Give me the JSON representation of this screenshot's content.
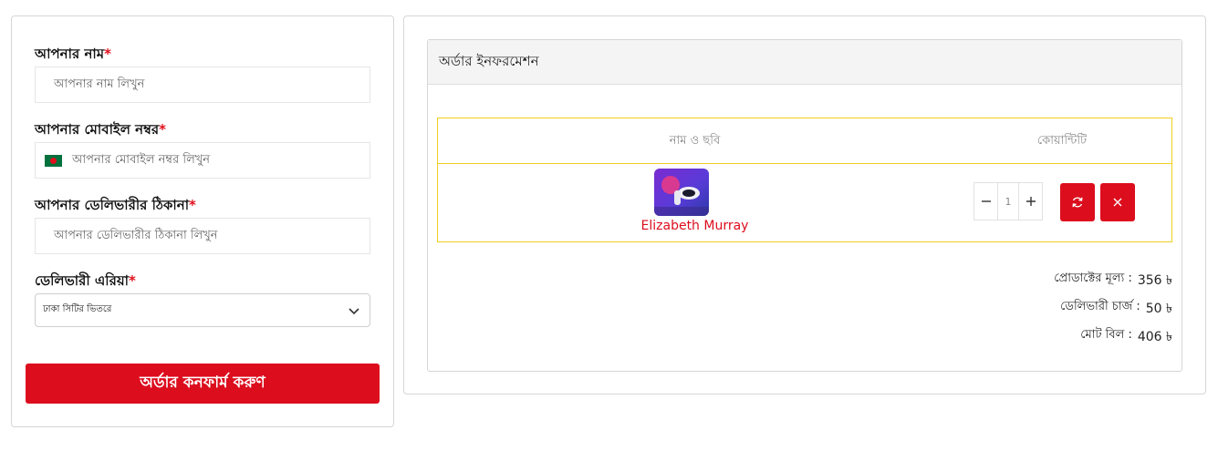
{
  "form": {
    "name_label": "আপনার নাম",
    "name_placeholder": "আপনার নাম লিখুন",
    "mobile_label": "আপনার মোবাইল নম্বর",
    "mobile_placeholder": "আপনার মোবাইল নম্বর লিখুন",
    "address_label": "আপনার ডেলিভারীর ঠিকানা",
    "address_placeholder": "আপনার ডেলিভারীর ঠিকানা লিখুন",
    "area_label": "ডেলিভারী এরিয়া",
    "area_selected": "ঢাকা সিটির ভিতরে",
    "required_mark": "*",
    "confirm_label": "অর্ডার কনফার্ম করুণ"
  },
  "order": {
    "title": "অর্ডার ইনফরমেশন",
    "columns": [
      "নাম ও ছবি",
      "কোয়ান্টিটি"
    ],
    "items": [
      {
        "name": "Elizabeth Murray",
        "quantity": "1"
      }
    ],
    "summary": [
      {
        "label": "প্রোডাক্টের মূল্য :",
        "value": "356 ৳"
      },
      {
        "label": "ডেলিভারী চার্জ :",
        "value": "50 ৳"
      },
      {
        "label": "মোট বিল :",
        "value": "406 ৳"
      }
    ]
  },
  "icons": {
    "flag": "bangladesh-flag-icon",
    "dropdown": "chevron-down-icon",
    "minus": "minus-icon",
    "plus": "plus-icon",
    "refresh": "refresh-icon",
    "remove": "close-icon"
  },
  "colors": {
    "accent": "#dc0d1d",
    "table_border": "#f2cf20",
    "flag_green": "#00713d"
  }
}
